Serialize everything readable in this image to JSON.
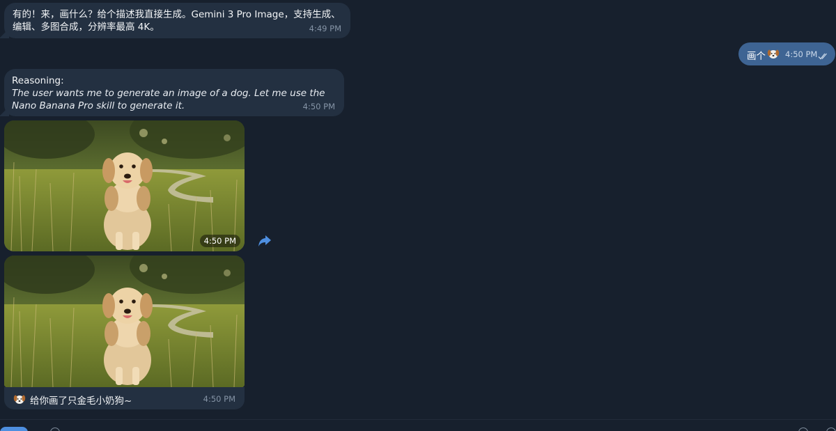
{
  "messages": {
    "m1": {
      "line1": "有的！来，画什么？给个描述我直接生成。Gemini 3 Pro Image，支持生成、",
      "line2": "编辑、多图合成，分辨率最高 4K。",
      "time": "4:49 PM"
    },
    "out": {
      "text": "画个",
      "emoji": "dog-face",
      "time": "4:50 PM",
      "status": "read-double-check"
    },
    "reasoning": {
      "title": "Reasoning:",
      "body": "The user wants me to generate an image of a dog. Let me use the Nano Banana Pro skill to generate it.",
      "time": "4:50 PM"
    },
    "photo1": {
      "time": "4:50 PM"
    },
    "photo2": {
      "caption": "给你画了只金毛小奶狗~",
      "caption_emoji": "dog-face",
      "time": "4:50 PM"
    }
  },
  "icons": {
    "forward": "forward-arrow-icon",
    "ticks": "double-check-icon"
  },
  "colors": {
    "background": "#17202d",
    "incoming_bubble": "#233041",
    "outgoing_bubble": "#3e6493",
    "accent": "#4e8fe0"
  }
}
